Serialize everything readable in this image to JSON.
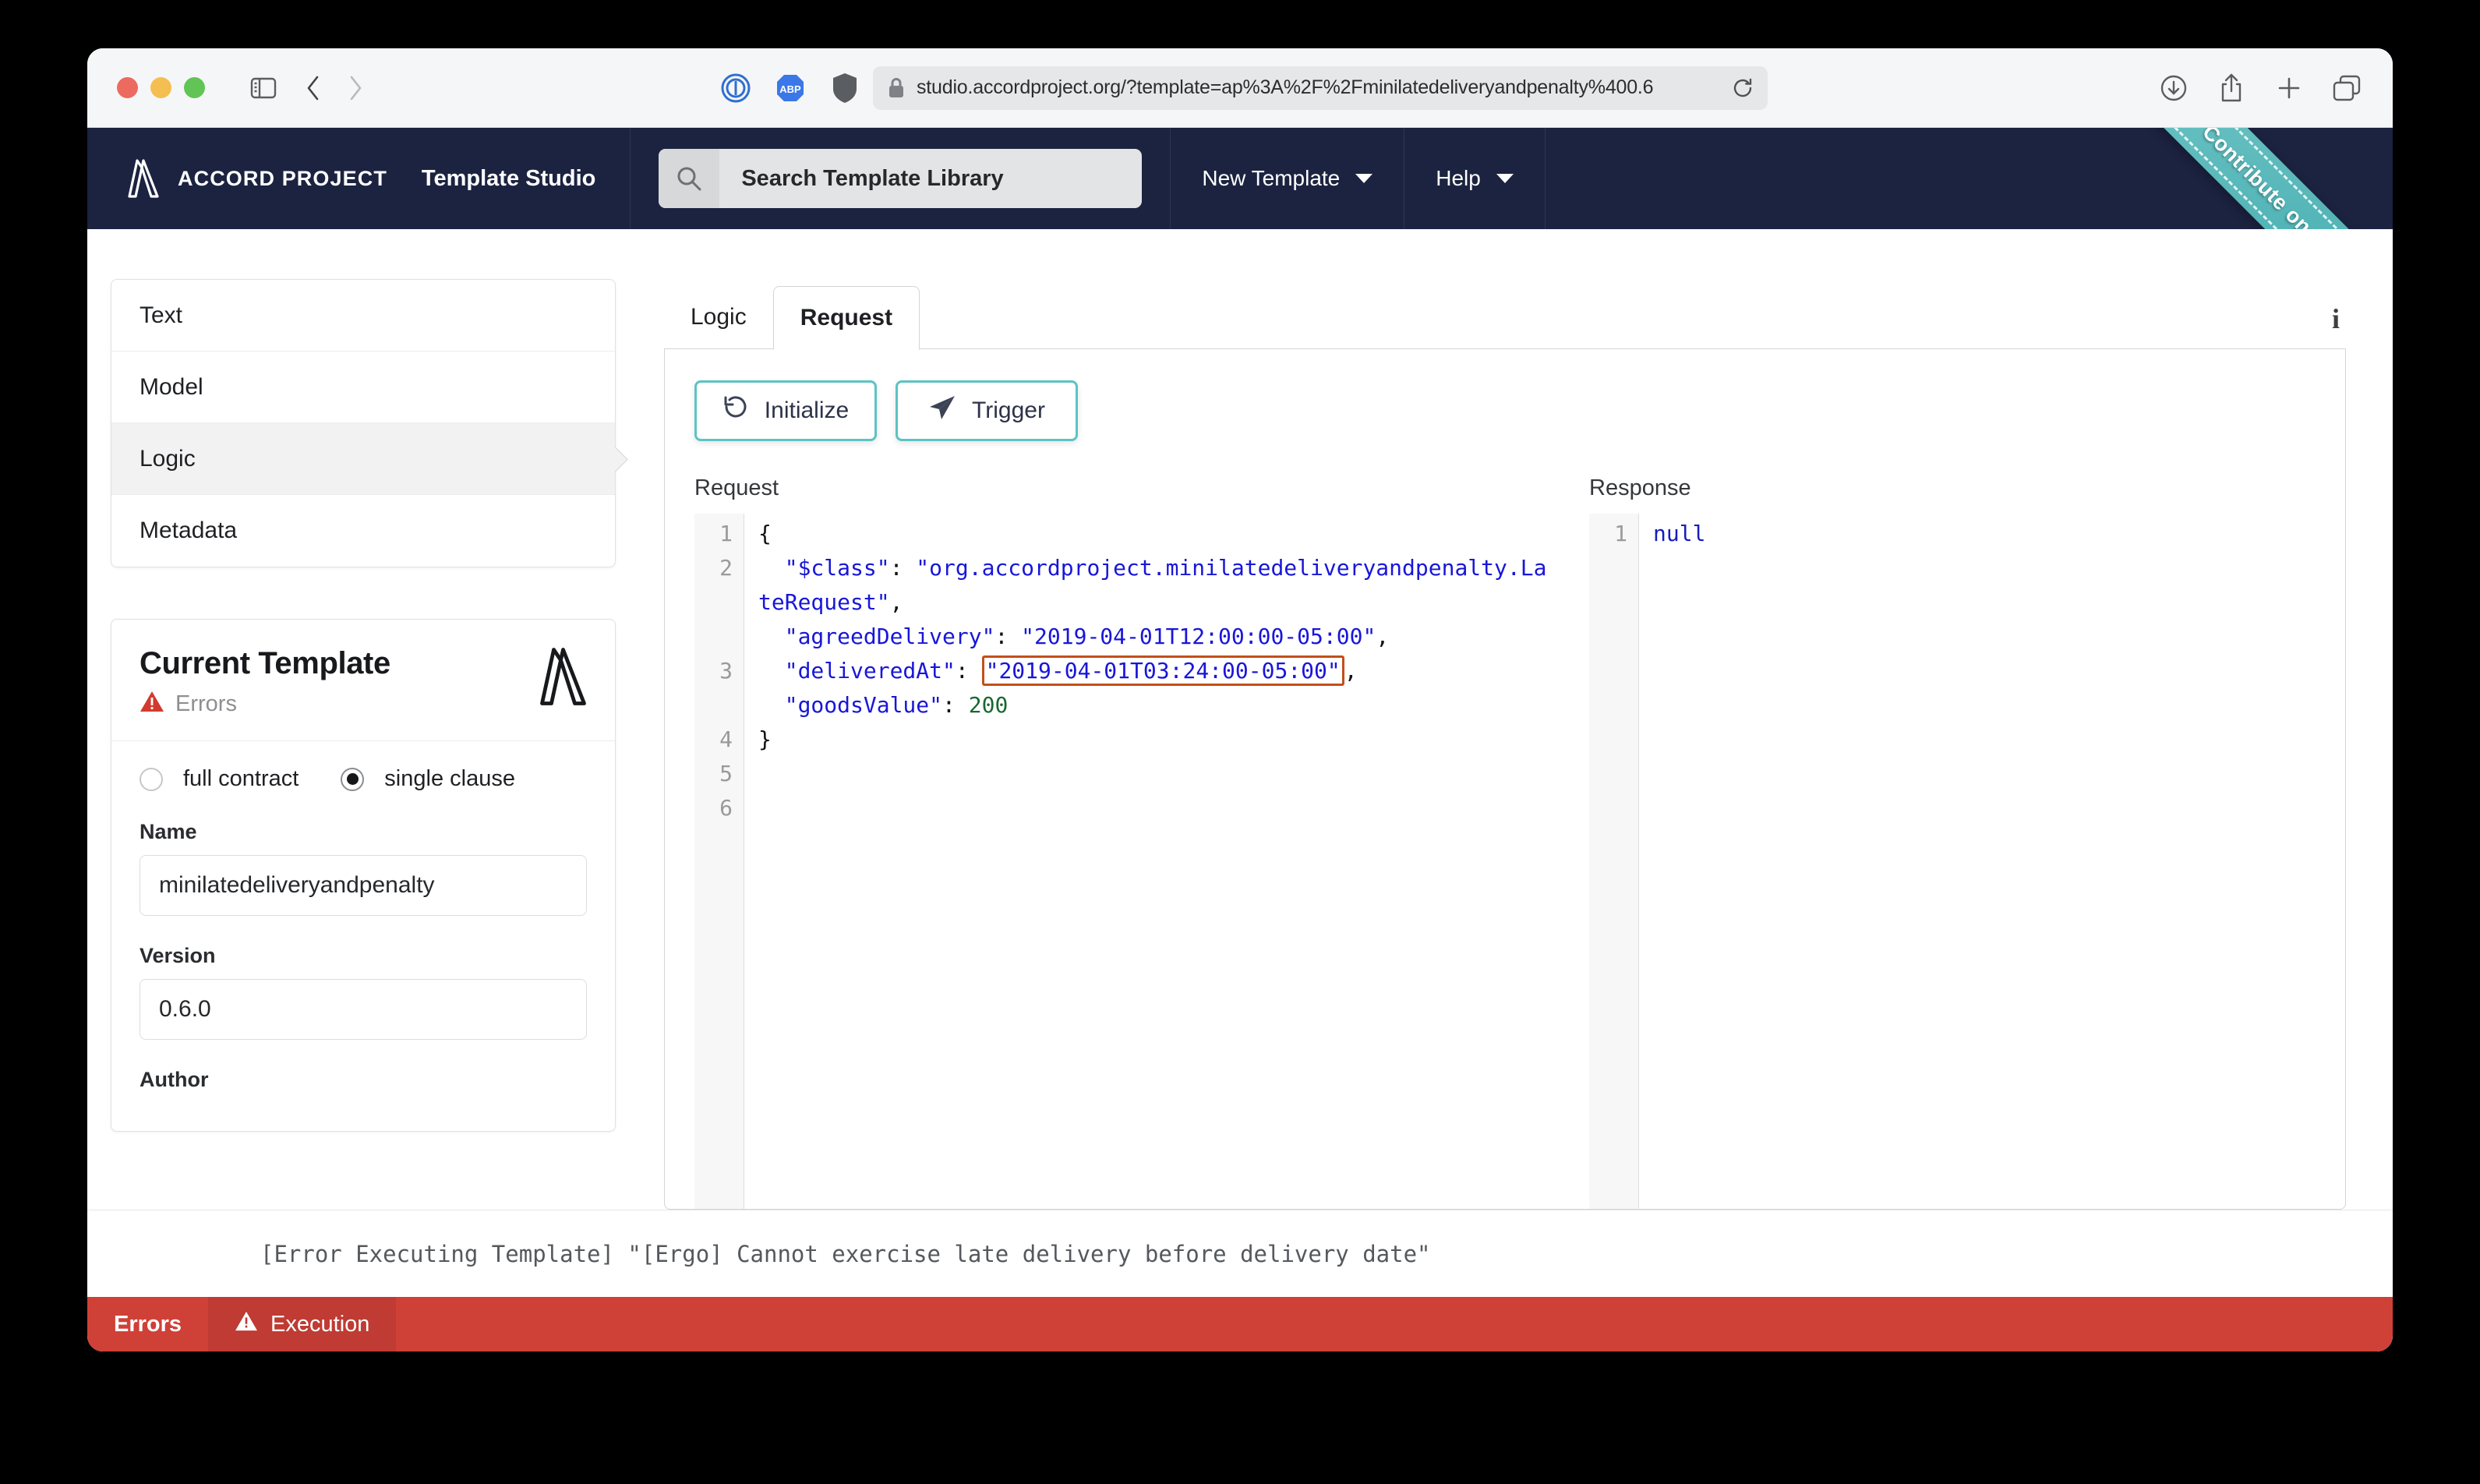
{
  "browser": {
    "url": "studio.accordproject.org/?template=ap%3A%2F%2Fminilatedeliveryandpenalty%400.6",
    "icons": {
      "sidebar_toggle": "sidebar-toggle-icon",
      "back": "back-arrow-icon",
      "forward": "forward-arrow-icon",
      "extension_1": "privacy-badger-icon",
      "extension_2": "adblock-plus-icon",
      "extension_3": "shield-icon",
      "lock": "lock-icon",
      "reload": "reload-icon",
      "downloads": "downloads-icon",
      "share": "share-icon",
      "new_tab": "plus-icon",
      "tab_overview": "tab-overview-icon"
    }
  },
  "navbar": {
    "brand": "ACCORD PROJECT",
    "product": "Template Studio",
    "search_placeholder": "Search Template Library",
    "menu": [
      {
        "label": "New Template"
      },
      {
        "label": "Help"
      }
    ],
    "ribbon": "Contribute on GitHub",
    "background": "#1c2340",
    "ribbon_color": "#3aa7ab"
  },
  "sidebar": {
    "items": [
      {
        "label": "Text",
        "active": false
      },
      {
        "label": "Model",
        "active": false
      },
      {
        "label": "Logic",
        "active": true
      },
      {
        "label": "Metadata",
        "active": false
      }
    ],
    "template_card": {
      "title": "Current Template",
      "status": "Errors",
      "status_color": "#d13b2e",
      "contract_type_options": [
        "full contract",
        "single clause"
      ],
      "contract_type_selected": "single clause",
      "fields": [
        {
          "label": "Name",
          "value": "minilatedeliveryandpenalty"
        },
        {
          "label": "Version",
          "value": "0.6.0"
        },
        {
          "label": "Author",
          "value": ""
        }
      ]
    }
  },
  "main": {
    "tabs": [
      {
        "label": "Logic",
        "active": false
      },
      {
        "label": "Request",
        "active": true
      }
    ],
    "info_icon": "info-icon",
    "toolbar": {
      "initialize_label": "Initialize",
      "trigger_label": "Trigger",
      "initialize_icon": "undo-icon",
      "trigger_icon": "paper-plane-icon",
      "accent": "#5cc3c3"
    },
    "request": {
      "title": "Request",
      "line_numbers": [
        "1",
        "2",
        "3",
        "4",
        "5",
        "6"
      ],
      "open_brace": "{",
      "close_brace": "}",
      "class_key": "\"$class\"",
      "class_value": "\"org.accordproject.minilatedeliveryandpenalty.LateRequest\"",
      "agreed_key": "\"agreedDelivery\"",
      "agreed_value": "\"2019-04-01T12:00:00-05:00\"",
      "delivered_key": "\"deliveredAt\"",
      "delivered_value": "\"2019-04-01T03:24:00-05:00\"",
      "goods_key": "\"goodsValue\"",
      "goods_value": "200",
      "colon": ":",
      "comma": ",",
      "highlight_color": "#c2501b"
    },
    "response": {
      "title": "Response",
      "line_numbers": [
        "1"
      ],
      "value": "null"
    }
  },
  "console": {
    "message": "[Error Executing Template] \"[Ergo] Cannot exercise late delivery before delivery date\"",
    "tabs": [
      {
        "label": "Errors",
        "icon": null
      },
      {
        "label": "Execution",
        "icon": "warning-icon"
      }
    ],
    "bar_color": "#cf4037"
  }
}
